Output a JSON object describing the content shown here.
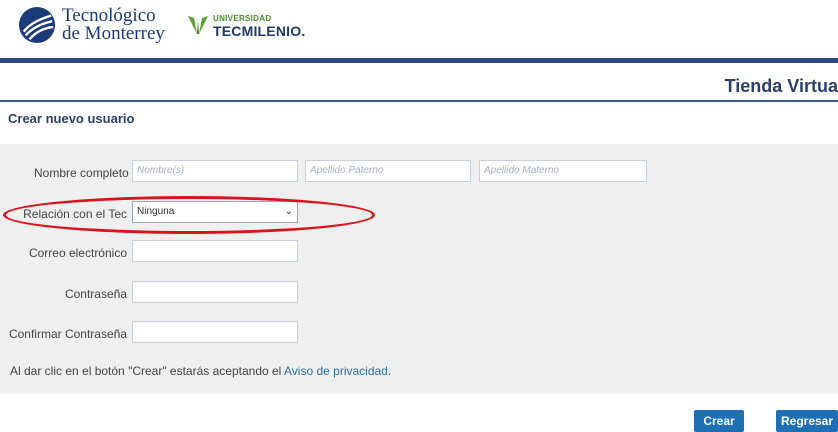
{
  "header": {
    "tec_logo_line1": "Tecnológico",
    "tec_logo_line2": "de Monterrey",
    "tecmilenio_small": "UNIVERSIDAD",
    "tecmilenio_big": "TECMILENIO."
  },
  "store_title": "Tienda Virtua",
  "section_title": "Crear nuevo usuario",
  "form": {
    "name_label": "Nombre completo",
    "first_name_placeholder": "Nombre(s)",
    "paternal_placeholder": "Apellido Paterno",
    "maternal_placeholder": "Apellido Materno",
    "relation_label": "Relación con el Tec",
    "relation_value": "Ninguna",
    "email_label": "Correo electrónico",
    "password_label": "Contraseña",
    "confirm_label": "Confirmar Contraseña"
  },
  "notice": {
    "text": "Al dar clic en el botón \"Crear\" estarás aceptando el",
    "link": "Aviso de privacidad",
    "end": "."
  },
  "buttons": {
    "create": "Crear",
    "back": "Regresar"
  },
  "colors": {
    "brand_blue": "#2c4a82",
    "button_blue": "#1f6fb5",
    "annotation_red": "#d8141b"
  }
}
